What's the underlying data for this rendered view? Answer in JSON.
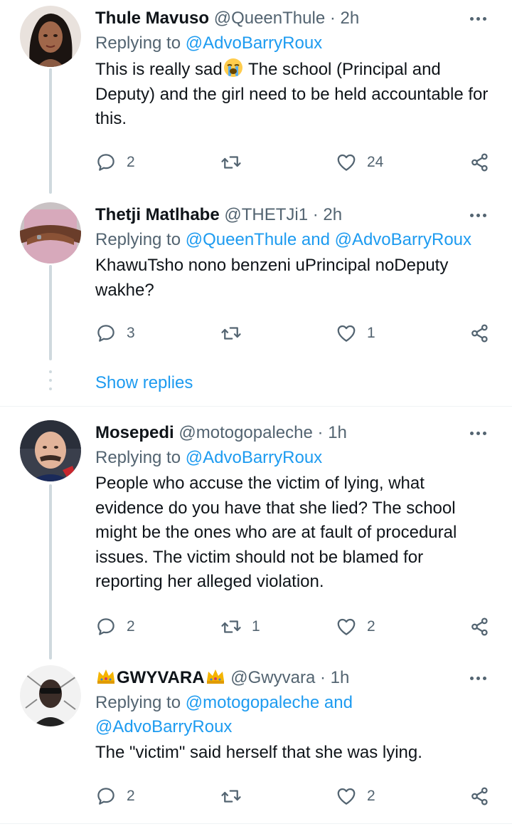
{
  "tweets": [
    {
      "name": "Thule Mavuso",
      "handle": "@QueenThule",
      "time": "2h",
      "reply_prefix": "Replying to",
      "reply_to": "@AdvoBarryRoux",
      "text_before_emoji": "This is really sad",
      "emoji": "loudly-crying-face-emoji",
      "text_after_emoji": " The school (Principal and Deputy) and the girl need to be held accountable for this.",
      "replies": "2",
      "retweets": "",
      "likes": "24"
    },
    {
      "name": "Thetji Matlhabe",
      "handle": "@THETJi1",
      "time": "2h",
      "reply_prefix": "Replying to",
      "reply_to": "@QueenThule and @AdvoBarryRoux",
      "text": "KhawuTsho nono benzeni uPrincipal noDeputy wakhe?",
      "replies": "3",
      "retweets": "",
      "likes": "1"
    },
    {
      "name": "Mosepedi",
      "handle": "@motogopaleche",
      "time": "1h",
      "reply_prefix": "Replying to",
      "reply_to": "@AdvoBarryRoux",
      "text": "People who accuse the victim of lying, what evidence do you have that she lied? The school might be the ones who are at fault of procedural issues. The victim should not be blamed for reporting her alleged violation.",
      "replies": "2",
      "retweets": "1",
      "likes": "2"
    },
    {
      "name": "GWYVARA",
      "name_decoration": "crown-emoji",
      "handle": "@Gwyvara",
      "time": "1h",
      "reply_prefix": "Replying to",
      "reply_to": "@motogopaleche and @AdvoBarryRoux",
      "text": "The \"victim\" said herself that she was lying.",
      "replies": "2",
      "retweets": "",
      "likes": "2"
    }
  ],
  "show_replies": "Show replies",
  "dot_separator": "·",
  "colors": {
    "link": "#1d9bf0",
    "secondary_text": "#536471",
    "primary_text": "#0f1419",
    "thread_line": "#cfd9de"
  }
}
